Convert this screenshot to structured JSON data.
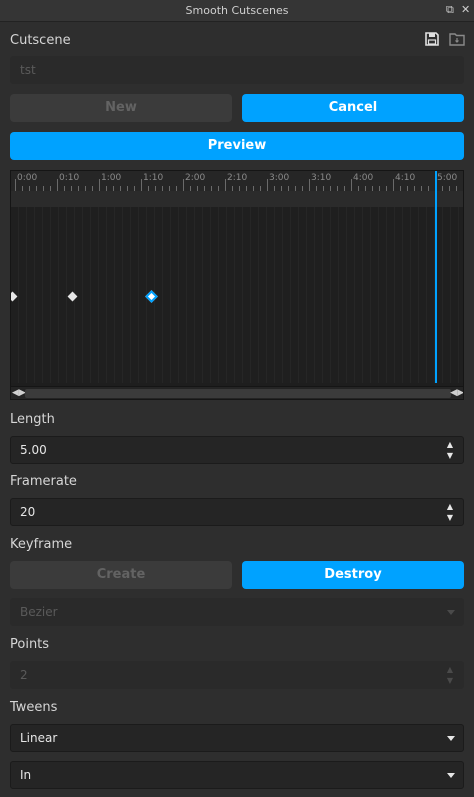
{
  "window": {
    "title": "Smooth Cutscenes"
  },
  "cutscene": {
    "label": "Cutscene",
    "input_placeholder": "tst",
    "new_label": "New",
    "cancel_label": "Cancel",
    "preview_label": "Preview"
  },
  "timeline": {
    "ticks": [
      "0:00",
      "0:10",
      "1:00",
      "1:10",
      "2:00",
      "2:10",
      "3:00",
      "3:10",
      "4:00",
      "4:10",
      "5:00"
    ]
  },
  "length": {
    "label": "Length",
    "value": "5.00"
  },
  "framerate": {
    "label": "Framerate",
    "value": "20"
  },
  "keyframe": {
    "label": "Keyframe",
    "create_label": "Create",
    "destroy_label": "Destroy",
    "easing_value": "Bezier"
  },
  "points": {
    "label": "Points",
    "value": "2"
  },
  "tweens": {
    "label": "Tweens",
    "style_value": "Linear",
    "direction_value": "In"
  },
  "colors": {
    "accent": "#00a2ff",
    "background": "#2e2e2e"
  }
}
